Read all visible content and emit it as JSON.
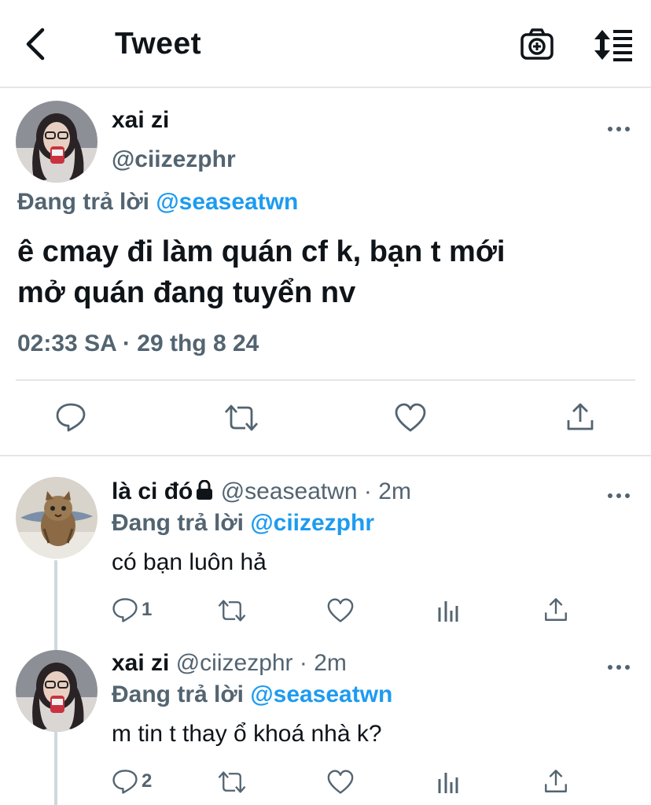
{
  "header": {
    "title": "Tweet",
    "back_icon": "chevron-left-icon",
    "camera_icon": "camera-plus-icon",
    "sort_icon": "sort-icon"
  },
  "main_tweet": {
    "display_name": "xai zi",
    "handle": "@ciizezphr",
    "replying_prefix": "Đang trả lời",
    "replying_to": "@seaseatwn",
    "text_line1": "ê cmay đi làm quán cf k, bạn t mới",
    "text_line2": "mở quán đang tuyển nv",
    "timestamp": "02:33 SA · 29 thg 8 24"
  },
  "replies": [
    {
      "display_name": "là ci đó",
      "handle": "@seaseatwn",
      "separator": " · ",
      "time": "2m",
      "replying_prefix": "Đang trả lời",
      "replying_to": "@ciizezphr",
      "text": "có bạn luôn hả",
      "reply_count": "1"
    },
    {
      "display_name": "xai zi",
      "handle": "@ciizezphr",
      "separator": " · ",
      "time": "2m",
      "replying_prefix": "Đang trả lời",
      "replying_to": "@seaseatwn",
      "text": "m tin t thay ổ khoá nhà k?",
      "reply_count": "2"
    }
  ],
  "colors": {
    "accent": "#1d9bf0",
    "secondary_text": "#536471",
    "divider": "#e6e6e6"
  }
}
